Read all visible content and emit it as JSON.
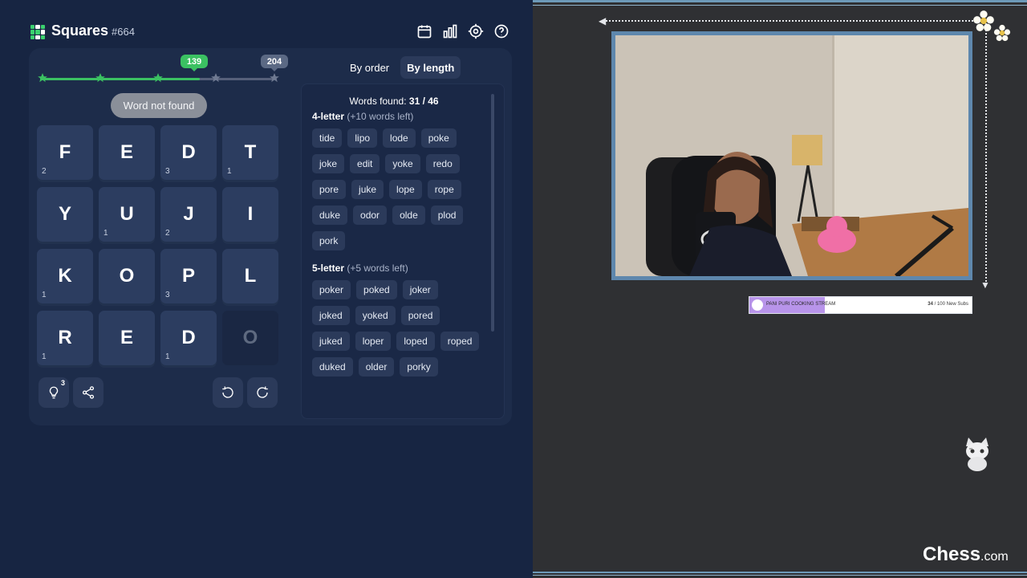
{
  "header": {
    "title": "Squares",
    "puzzle_number": "#664",
    "icons": [
      "calendar-icon",
      "stats-icon",
      "settings-icon",
      "help-icon"
    ]
  },
  "progress": {
    "current_score": "139",
    "max_score": "204",
    "current_fraction": 0.681
  },
  "toast": "Word not found",
  "grid": [
    {
      "letter": "F",
      "count": "2"
    },
    {
      "letter": "E",
      "count": ""
    },
    {
      "letter": "D",
      "count": "3"
    },
    {
      "letter": "T",
      "count": "1"
    },
    {
      "letter": "Y",
      "count": ""
    },
    {
      "letter": "U",
      "count": "1"
    },
    {
      "letter": "J",
      "count": "2"
    },
    {
      "letter": "I",
      "count": ""
    },
    {
      "letter": "K",
      "count": "1"
    },
    {
      "letter": "O",
      "count": ""
    },
    {
      "letter": "P",
      "count": "3"
    },
    {
      "letter": "L",
      "count": ""
    },
    {
      "letter": "R",
      "count": "1"
    },
    {
      "letter": "E",
      "count": ""
    },
    {
      "letter": "D",
      "count": "1"
    },
    {
      "letter": "O",
      "count": ""
    }
  ],
  "controls": {
    "hint_count": "3"
  },
  "tabs": {
    "by_order": "By order",
    "by_length": "By length"
  },
  "words": {
    "found_label": "Words found:",
    "found_value": "31 / 46",
    "four_letter_title": "4-letter",
    "four_letter_left": "(+10 words left)",
    "four_letter": [
      "tide",
      "lipo",
      "lode",
      "poke",
      "joke",
      "edit",
      "yoke",
      "redo",
      "pore",
      "juke",
      "lope",
      "rope",
      "duke",
      "odor",
      "olde",
      "plod",
      "pork"
    ],
    "five_letter_title": "5-letter",
    "five_letter_left": "(+5 words left)",
    "five_letter": [
      "poker",
      "poked",
      "joker",
      "joked",
      "yoked",
      "pored",
      "juked",
      "loper",
      "loped",
      "roped",
      "duked",
      "older",
      "porky"
    ]
  },
  "stream": {
    "sub_goal_label": "PANI PURI COOKING STREAM",
    "sub_goal_current": "34",
    "sub_goal_rest": "/ 100 New Subs",
    "sub_goal_fraction": 0.34,
    "brand": "Chess",
    "brand_suffix": ".com"
  },
  "colors": {
    "game_bg": "#172542",
    "tile_bg": "#2c3d60",
    "accent_green": "#3bc162",
    "stream_bg": "#2f3033"
  }
}
